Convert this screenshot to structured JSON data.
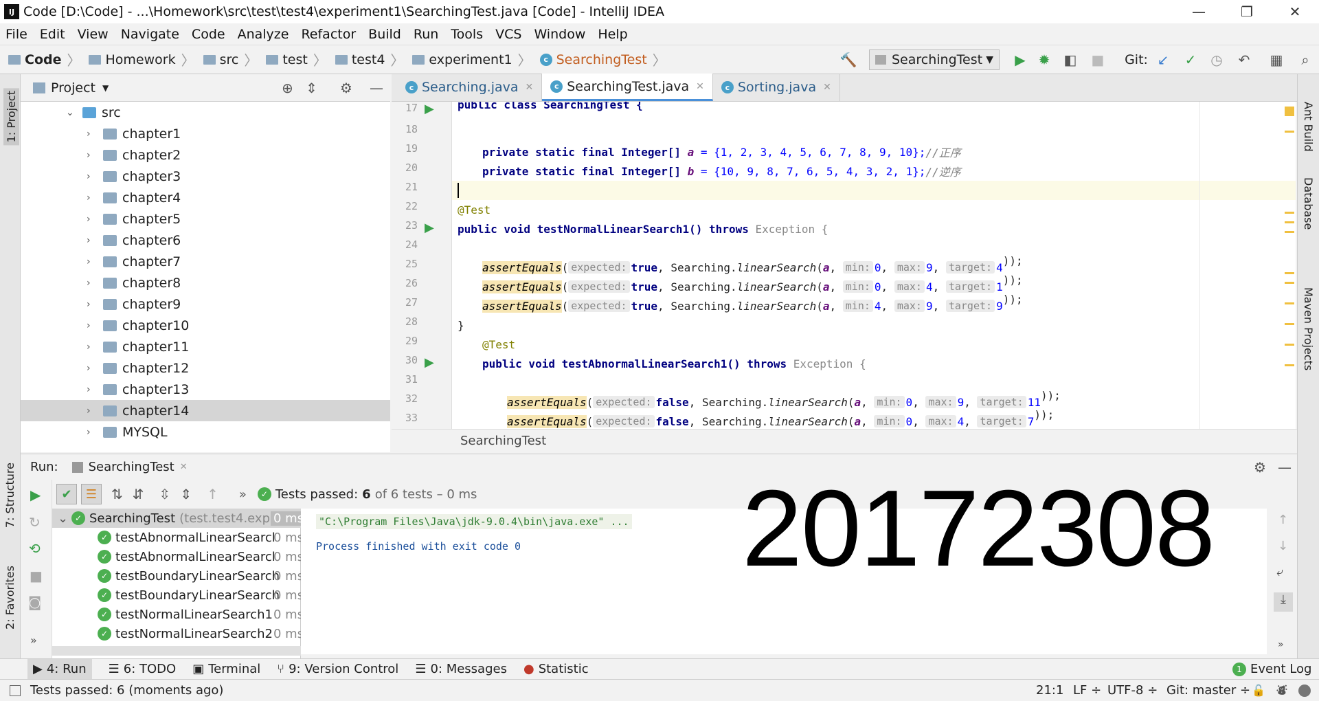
{
  "window": {
    "title": "Code [D:\\Code] - ...\\Homework\\src\\test\\test4\\experiment1\\SearchingTest.java [Code] - IntelliJ IDEA",
    "logo": "IJ"
  },
  "menu": [
    "File",
    "Edit",
    "View",
    "Navigate",
    "Code",
    "Analyze",
    "Refactor",
    "Build",
    "Run",
    "Tools",
    "VCS",
    "Window",
    "Help"
  ],
  "breadcrumbs": [
    "Code",
    "Homework",
    "src",
    "test",
    "test4",
    "experiment1",
    "SearchingTest"
  ],
  "run_config": "SearchingTest",
  "git_label": "Git:",
  "project": {
    "title": "Project",
    "items": [
      {
        "label": "src",
        "level": 0,
        "expanded": true
      },
      {
        "label": "chapter1",
        "level": 1
      },
      {
        "label": "chapter2",
        "level": 1
      },
      {
        "label": "chapter3",
        "level": 1
      },
      {
        "label": "chapter4",
        "level": 1
      },
      {
        "label": "chapter5",
        "level": 1
      },
      {
        "label": "chapter6",
        "level": 1
      },
      {
        "label": "chapter7",
        "level": 1
      },
      {
        "label": "chapter8",
        "level": 1
      },
      {
        "label": "chapter9",
        "level": 1
      },
      {
        "label": "chapter10",
        "level": 1
      },
      {
        "label": "chapter11",
        "level": 1
      },
      {
        "label": "chapter12",
        "level": 1
      },
      {
        "label": "chapter13",
        "level": 1
      },
      {
        "label": "chapter14",
        "level": 1,
        "selected": true
      },
      {
        "label": "MYSQL",
        "level": 1
      }
    ]
  },
  "tabs": [
    {
      "label": "Searching.java"
    },
    {
      "label": "SearchingTest.java",
      "active": true
    },
    {
      "label": "Sorting.java"
    }
  ],
  "code": {
    "line_numbers": [
      "17",
      "18",
      "19",
      "20",
      "21",
      "22",
      "23",
      "24",
      "25",
      "26",
      "27",
      "28",
      "29",
      "30",
      "31",
      "32",
      "33"
    ],
    "l17": "public class SearchingTest {",
    "l19_decl": "private static final Integer[]",
    "l19_var": "a",
    "l19_val": " = {1, 2, 3, 4, 5, 6, 7, 8, 9, 10};",
    "l19_cmt": "//正序",
    "l20_decl": "private static final Integer[]",
    "l20_var": "b",
    "l20_val": " = {10, 9, 8, 7, 6, 5, 4, 3, 2, 1};",
    "l20_cmt": "//逆序",
    "l22": "@Test",
    "l23_a": "public void testNormalLinearSearch1() ",
    "l23_throws": "throws",
    "l23_exc": " Exception {",
    "assert": "assertEquals",
    "l25": {
      "expected": "true",
      "min": "0",
      "max": "9",
      "target": "4"
    },
    "l26": {
      "expected": "true",
      "min": "0",
      "max": "4",
      "target": "1"
    },
    "l27": {
      "expected": "true",
      "min": "4",
      "max": "9",
      "target": "9"
    },
    "l28": "}",
    "l29": "@Test",
    "l30_a": "public void testAbnormalLinearSearch1() ",
    "l30_throws": "throws",
    "l30_exc": " Exception {",
    "l32": {
      "expected": "false",
      "min": "0",
      "max": "9",
      "target": "11"
    },
    "l33": {
      "expected": "false",
      "min": "0",
      "max": "4",
      "target": "7"
    },
    "hints": {
      "expected": "expected:",
      "min": "min:",
      "max": "max:",
      "target": "target:"
    },
    "call": "Searching.",
    "method": "linearSearch",
    "arr_a": "a"
  },
  "editor_breadcrumb": "SearchingTest",
  "run_panel": {
    "label": "Run:",
    "tab": "SearchingTest",
    "status": "Tests passed:",
    "passed": "6",
    "total": "of 6 tests – 0 ms",
    "tests": [
      {
        "name": "SearchingTest",
        "detail": "(test.test4.expe",
        "time": "0 ms",
        "root": true
      },
      {
        "name": "testAbnormalLinearSearcl",
        "time": "0 ms"
      },
      {
        "name": "testAbnormalLinearSearcl",
        "time": "0 ms"
      },
      {
        "name": "testBoundaryLinearSearch",
        "time": "0 ms"
      },
      {
        "name": "testBoundaryLinearSearch",
        "time": "0 ms"
      },
      {
        "name": "testNormalLinearSearch1",
        "time": "0 ms"
      },
      {
        "name": "testNormalLinearSearch2",
        "time": "0 ms"
      }
    ],
    "console_cmd": "\"C:\\Program Files\\Java\\jdk-9.0.4\\bin\\java.exe\" ...",
    "console_exit": "Process finished with exit code 0"
  },
  "watermark": "20172308",
  "tool_windows": [
    "4: Run",
    "6: TODO",
    "Terminal",
    "9: Version Control",
    "0: Messages",
    "Statistic"
  ],
  "event_log": "Event Log",
  "status": {
    "message": "Tests passed: 6 (moments ago)",
    "position": "21:1",
    "line_sep": "LF ÷",
    "encoding": "UTF-8 ÷",
    "git": "Git: master ÷"
  },
  "side_left": [
    "1: Project",
    "7: Structure",
    "2: Favorites"
  ],
  "side_right": [
    "Ant Build",
    "Database",
    "Maven Projects"
  ]
}
